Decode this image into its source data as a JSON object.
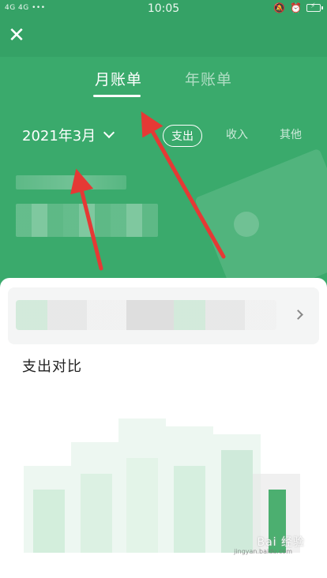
{
  "status_bar": {
    "network": "4G 4G ••• ",
    "time": "10:05"
  },
  "tabs": [
    {
      "label": "月账单",
      "active": true
    },
    {
      "label": "年账单",
      "active": false
    }
  ],
  "date_selector": {
    "label": "2021年3月"
  },
  "filters": [
    {
      "label": "支出",
      "active": true
    },
    {
      "label": "收入",
      "active": false
    },
    {
      "label": "其他",
      "active": false
    }
  ],
  "section": {
    "title": "支出对比"
  },
  "watermark": {
    "text": "Bai 经验",
    "sub": "jingyan.baidu.com"
  },
  "colors": {
    "header_green": "#3aaa6c",
    "arrow_red": "#e53935",
    "bar_green": "#4caf70"
  },
  "icons": {
    "close": "close-icon",
    "date_chevron": "chevron-down-icon",
    "card_chevron": "chevron-right-icon"
  }
}
